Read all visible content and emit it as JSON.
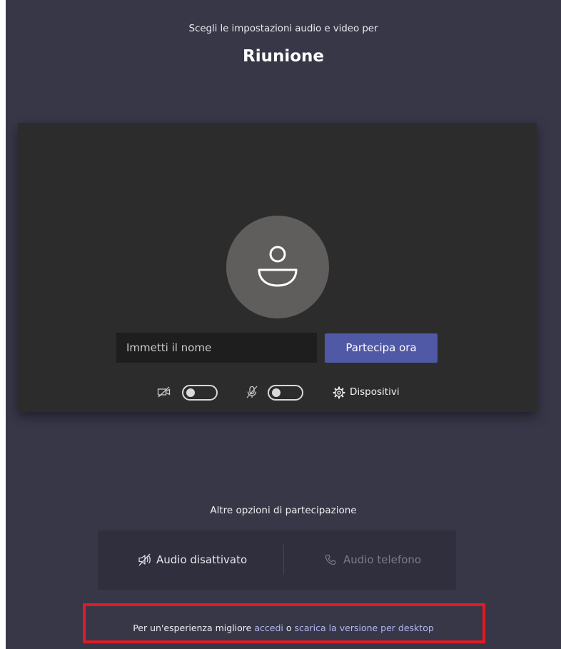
{
  "header": {
    "subtitle": "Scegli le impostazioni audio e video per",
    "meeting_title": "Riunione"
  },
  "preview": {
    "avatar_icon": "person-avatar-icon",
    "name_input": {
      "value": "",
      "placeholder": "Immetti il nome"
    },
    "join_button_label": "Partecipa ora",
    "controls": {
      "camera_icon": "camera-off-icon",
      "camera_toggle_on": false,
      "mic_icon": "mic-off-icon",
      "mic_toggle_on": false,
      "devices_icon": "gear-icon",
      "devices_label": "Dispositivi"
    }
  },
  "other_options": {
    "heading": "Altre opzioni di partecipazione",
    "audio_off": {
      "icon": "speaker-off-icon",
      "label": "Audio disattivato"
    },
    "phone_audio": {
      "icon": "phone-icon",
      "label": "Audio telefono",
      "disabled": true
    }
  },
  "footer": {
    "prefix": "Per un'esperienza migliore ",
    "sign_in_link": "accedi",
    "middle": " o ",
    "download_link": "scarica la versione per desktop"
  },
  "colors": {
    "background": "#373748",
    "preview_panel": "#2d2c2c",
    "primary_button": "#5059a5",
    "link": "#b3b8ee",
    "highlight": "#e01b24"
  }
}
